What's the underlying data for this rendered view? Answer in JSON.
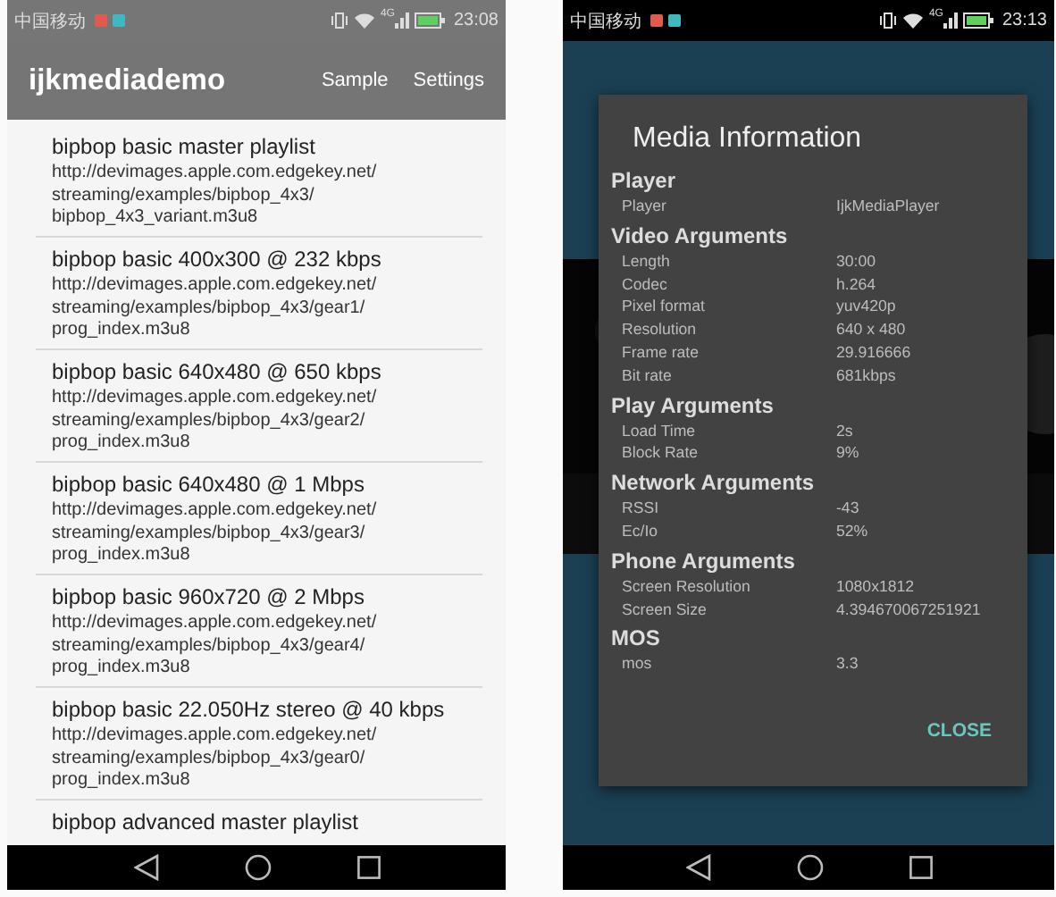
{
  "list_screen": {
    "status_bar": {
      "carrier": "中国移动",
      "network": "4G",
      "time": "23:08"
    },
    "app_bar": {
      "title": "ijkmediademo",
      "actions": [
        "Sample",
        "Settings"
      ]
    },
    "items": [
      {
        "title": "bipbop basic master playlist",
        "url": "http://devimages.apple.com.edgekey.net/\nstreaming/examples/bipbop_4x3/\nbipbop_4x3_variant.m3u8"
      },
      {
        "title": "bipbop basic 400x300 @ 232 kbps",
        "url": "http://devimages.apple.com.edgekey.net/\nstreaming/examples/bipbop_4x3/gear1/\nprog_index.m3u8"
      },
      {
        "title": "bipbop basic 640x480 @ 650 kbps",
        "url": "http://devimages.apple.com.edgekey.net/\nstreaming/examples/bipbop_4x3/gear2/\nprog_index.m3u8"
      },
      {
        "title": "bipbop basic 640x480 @ 1 Mbps",
        "url": "http://devimages.apple.com.edgekey.net/\nstreaming/examples/bipbop_4x3/gear3/\nprog_index.m3u8"
      },
      {
        "title": "bipbop basic 960x720 @ 2 Mbps",
        "url": "http://devimages.apple.com.edgekey.net/\nstreaming/examples/bipbop_4x3/gear4/\nprog_index.m3u8"
      },
      {
        "title": "bipbop basic 22.050Hz stereo @ 40 kbps",
        "url": "http://devimages.apple.com.edgekey.net/\nstreaming/examples/bipbop_4x3/gear0/\nprog_index.m3u8"
      },
      {
        "title": "bipbop advanced master playlist"
      }
    ]
  },
  "player_screen": {
    "status_bar": {
      "carrier": "中国移动",
      "network": "4G",
      "time": "23:13"
    },
    "dialog": {
      "title": "Media Information",
      "sections": [
        {
          "heading": "Player",
          "rows": [
            {
              "label": "Player",
              "value": "IjkMediaPlayer"
            }
          ]
        },
        {
          "heading": "Video Arguments",
          "rows": [
            {
              "label": "Length",
              "value": "30:00"
            },
            {
              "label": "Codec",
              "value": "h.264"
            },
            {
              "label": "Pixel format",
              "value": "yuv420p"
            },
            {
              "label": "Resolution",
              "value": "640 x 480"
            },
            {
              "label": "Frame rate",
              "value": "29.916666"
            },
            {
              "label": "Bit rate",
              "value": "681kbps"
            }
          ]
        },
        {
          "heading": "Play Arguments",
          "rows": [
            {
              "label": "Load Time",
              "value": "2s"
            },
            {
              "label": "Block Rate",
              "value": "9%"
            }
          ]
        },
        {
          "heading": "Network Arguments",
          "rows": [
            {
              "label": "RSSI",
              "value": "-43"
            },
            {
              "label": "Ec/Io",
              "value": "52%"
            }
          ]
        },
        {
          "heading": "Phone Arguments",
          "rows": [
            {
              "label": "Screen Resolution",
              "value": "1080x1812"
            },
            {
              "label": "Screen Size",
              "value": "4.394670067251921"
            }
          ]
        },
        {
          "heading": "MOS",
          "rows": [
            {
              "label": "mos",
              "value": "3.3"
            }
          ]
        }
      ],
      "button": "CLOSE"
    }
  }
}
